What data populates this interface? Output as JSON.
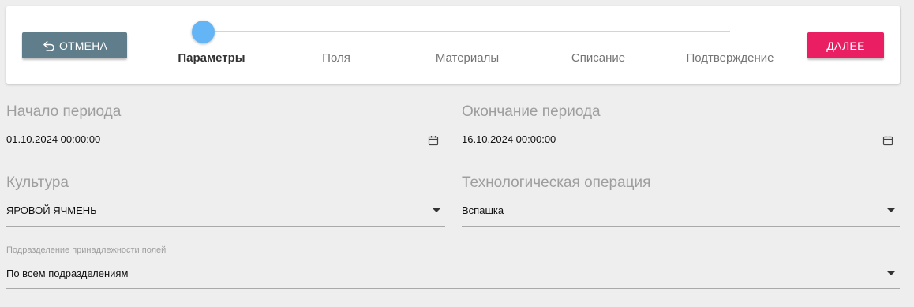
{
  "toolbar": {
    "cancel_label": "ОТМЕНА",
    "next_label": "ДАЛЕЕ"
  },
  "stepper": {
    "steps": [
      {
        "label": "Параметры",
        "active": true
      },
      {
        "label": "Поля",
        "active": false
      },
      {
        "label": "Материалы",
        "active": false
      },
      {
        "label": "Списание",
        "active": false
      },
      {
        "label": "Подтверждение",
        "active": false
      }
    ]
  },
  "form": {
    "period_start": {
      "label": "Начало периода",
      "value": "01.10.2024 00:00:00",
      "icon": "calendar-icon"
    },
    "period_end": {
      "label": "Окончание периода",
      "value": "16.10.2024 00:00:00",
      "icon": "calendar-icon"
    },
    "crop": {
      "label": "Культура",
      "value": "ЯРОВОЙ ЯЧМЕНЬ",
      "icon": "chevron-down-icon"
    },
    "operation": {
      "label": "Технологическая операция",
      "value": "Вспашка",
      "icon": "chevron-down-icon"
    },
    "division": {
      "label": "Подразделение принадлежности полей",
      "value": "По всем подразделениям",
      "icon": "chevron-down-icon"
    }
  },
  "colors": {
    "background": "#eeeeee",
    "cancel_button": "#607d8b",
    "next_button": "#e91e63",
    "stepper_active": "#64b5f6"
  }
}
